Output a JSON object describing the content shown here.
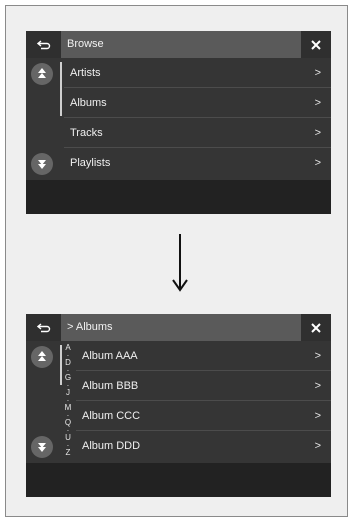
{
  "screen1": {
    "title": "Browse",
    "items": [
      {
        "label": "Artists",
        "chevron": ">"
      },
      {
        "label": "Albums",
        "chevron": ">"
      },
      {
        "label": "Tracks",
        "chevron": ">"
      },
      {
        "label": "Playlists",
        "chevron": ">"
      }
    ]
  },
  "screen2": {
    "title": "> Albums",
    "alpha_index": [
      "A",
      "D",
      "G",
      "J",
      "M",
      "Q",
      "U",
      "Z"
    ],
    "items": [
      {
        "label": "Album AAA",
        "chevron": ">"
      },
      {
        "label": "Album BBB",
        "chevron": ">"
      },
      {
        "label": "Album CCC",
        "chevron": ">"
      },
      {
        "label": "Album DDD",
        "chevron": ">"
      }
    ]
  },
  "icons": {
    "back": "back-arrow-icon",
    "close": "close-icon",
    "scroll_up": "scroll-up-icon",
    "scroll_down": "scroll-down-icon",
    "transition": "down-arrow-icon"
  }
}
